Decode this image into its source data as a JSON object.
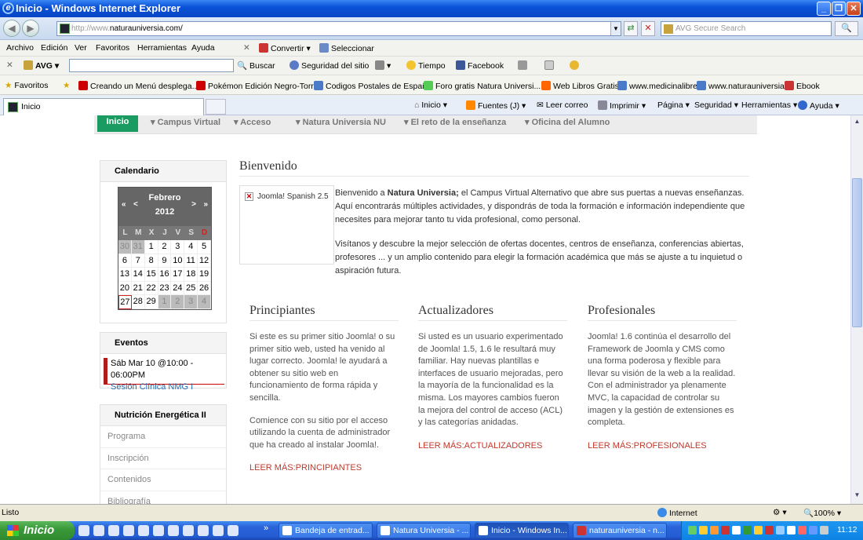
{
  "window": {
    "title": "Inicio - Windows Internet Explorer"
  },
  "address": {
    "url_prefix": "http://www.",
    "url_main": "naturauniversia.com/",
    "search_placeholder": "AVG Secure Search"
  },
  "menu": [
    "Archivo",
    "Edición",
    "Ver",
    "Favoritos",
    "Herramientas",
    "Ayuda"
  ],
  "toolbar1": {
    "convertir": "Convertir",
    "seleccionar": "Seleccionar"
  },
  "avg": {
    "label": "AVG",
    "buscar": "Buscar",
    "seguridad": "Seguridad del sitio",
    "tiempo": "Tiempo",
    "facebook": "Facebook"
  },
  "favorites": {
    "label": "Favoritos",
    "items": [
      "Creando un Menú desplega...",
      "Pokémon Edición Negro-Torr...",
      "Codigos Postales de España",
      "Foro gratis  Natura Universi...",
      "Web Libros Gratis",
      "www.medicinalibre",
      "www.naturauniversia",
      "Ebook"
    ]
  },
  "tab": {
    "label": "Inicio"
  },
  "commandbar": {
    "inicio": "Inicio",
    "fuentes": "Fuentes (J)",
    "leer_correo": "Leer correo",
    "imprimir": "Imprimir",
    "pagina": "Página",
    "seguridad": "Seguridad",
    "herramientas": "Herramientas",
    "ayuda": "Ayuda"
  },
  "page": {
    "nav": [
      "Inicio",
      "Campus Virtual",
      "Acceso",
      "Natura Universia NU",
      "El reto de la enseñanza",
      "Oficina del Alumno"
    ],
    "calendario": {
      "title": "Calendario",
      "month": "Febrero",
      "year": "2012",
      "nav_prev_year": "«",
      "nav_prev": "<",
      "nav_next": ">",
      "nav_next_year": "»",
      "weekdays": [
        "L",
        "M",
        "X",
        "J",
        "V",
        "S",
        "D"
      ],
      "weeks": [
        [
          "30",
          "31",
          "1",
          "2",
          "3",
          "4",
          "5"
        ],
        [
          "6",
          "7",
          "8",
          "9",
          "10",
          "11",
          "12"
        ],
        [
          "13",
          "14",
          "15",
          "16",
          "17",
          "18",
          "19"
        ],
        [
          "20",
          "21",
          "22",
          "23",
          "24",
          "25",
          "26"
        ],
        [
          "27",
          "28",
          "29",
          "1",
          "2",
          "3",
          "4"
        ]
      ],
      "today": "27",
      "sunday_color": "#cc2222"
    },
    "eventos": {
      "title": "Eventos",
      "date": "Sáb Mar 10 @10:00 - 06:00PM",
      "link": "Sesión Clínica NMG I"
    },
    "nutricion": {
      "title": "Nutrición Energética II",
      "items": [
        "Programa",
        "Inscripción",
        "Contenidos",
        "Bibliografía"
      ]
    },
    "main": {
      "heading": "Bienvenido",
      "image_alt": "Joomla! Spanish 2.5",
      "intro_a": "Bienvenido a ",
      "intro_bold": "Natura Universia;",
      "intro_b": " el Campus Virtual Alternativo que abre sus puertas a nuevas enseñanzas. Aquí encontrarás múltiples actividades, y dispondrás de toda la formación e información independiente que necesites para mejorar tanto tu vida profesional, como personal.",
      "intro2": "Visítanos y descubre la mejor selección de ofertas docentes, centros de enseñanza, conferencias abiertas, profesores ... y un amplio contenido para elegir la formación académica que más se ajuste a tu inquietud o aspiración futura."
    },
    "columns": [
      {
        "title": "Principiantes",
        "p1": "Si este es su primer sitio Joomla! o su primer sitio web, usted ha venido al lugar correcto. Joomla! le ayudará a obtener su sitio web en funcionamiento de forma rápida y sencilla.",
        "p2": "Comience con su sitio por el acceso utilizando la cuenta de administrador que ha creado al instalar Joomla!.",
        "link": "LEER MÁS:PRINCIPIANTES"
      },
      {
        "title": "Actualizadores",
        "p1": "Si usted es un usuario experimentado de Joomla! 1.5, 1.6 le resultará muy familiar. Hay nuevas plantillas e interfaces de usuario mejoradas, pero la mayoría de la funcionalidad es la misma. Los mayores cambios fueron la mejora del control de acceso (ACL) y las categorías anidadas.",
        "link": "LEER MÁS:ACTUALIZADORES"
      },
      {
        "title": "Profesionales",
        "p1": "Joomla! 1.6 continúa el desarrollo del Framework de Joomla y CMS como una forma poderosa y flexible para llevar su visión de la web a la realidad. Con el administrador ya plenamente MVC, la capacidad de controlar su imagen y la gestión de extensiones es completa.",
        "link": "LEER MÁS:PROFESIONALES"
      }
    ]
  },
  "status": {
    "text": "Listo",
    "zone": "Internet",
    "zoom": "100%"
  },
  "taskbar": {
    "start": "Inicio",
    "tasks": [
      "Bandeja de entrad...",
      "Natura Universia - ...",
      "Inicio - Windows In...",
      "naturauniversia - n..."
    ],
    "clock": "11:12"
  },
  "colors": {
    "accent_green": "#1a9b62",
    "link_red": "#c0392b",
    "event_red": "#b01c1c"
  }
}
